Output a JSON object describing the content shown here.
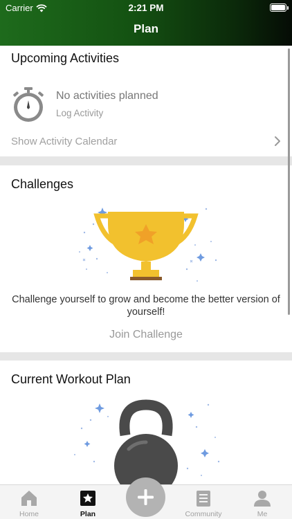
{
  "status_bar": {
    "carrier": "Carrier",
    "time": "2:21 PM"
  },
  "header": {
    "title": "Plan"
  },
  "upcoming": {
    "title": "Upcoming Activities",
    "empty_title": "No activities planned",
    "log_link": "Log Activity",
    "calendar_link": "Show Activity Calendar"
  },
  "challenges": {
    "title": "Challenges",
    "description": "Challenge yourself to grow and become the better version of yourself!",
    "join_label": "Join Challenge"
  },
  "workout": {
    "title": "Current Workout Plan"
  },
  "tabbar": {
    "home": "Home",
    "plan": "Plan",
    "community": "Community",
    "me": "Me"
  },
  "colors": {
    "header_gradient_start": "#1e6b1c",
    "header_gradient_end": "#050c05",
    "trophy": "#f2c12e",
    "fab": "#b3b3b3"
  }
}
